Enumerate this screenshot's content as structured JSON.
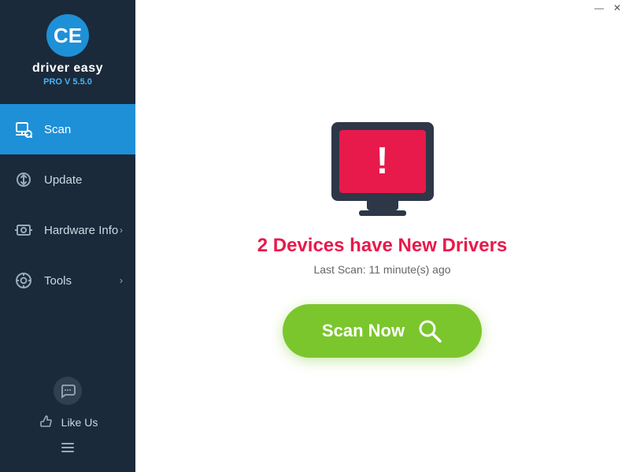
{
  "titlebar": {
    "minimize_label": "—",
    "close_label": "✕"
  },
  "sidebar": {
    "logo_text": "driver easy",
    "logo_version": "PRO V 5.5.0",
    "nav_items": [
      {
        "id": "scan",
        "label": "Scan",
        "active": true,
        "has_arrow": false
      },
      {
        "id": "update",
        "label": "Update",
        "active": false,
        "has_arrow": false
      },
      {
        "id": "hardware-info",
        "label": "Hardware Info",
        "active": false,
        "has_arrow": true
      },
      {
        "id": "tools",
        "label": "Tools",
        "active": false,
        "has_arrow": true
      }
    ],
    "like_us_label": "Like Us"
  },
  "main": {
    "alert_title": "2 Devices have New Drivers",
    "last_scan_label": "Last Scan: 11 minute(s) ago",
    "scan_now_label": "Scan Now"
  }
}
